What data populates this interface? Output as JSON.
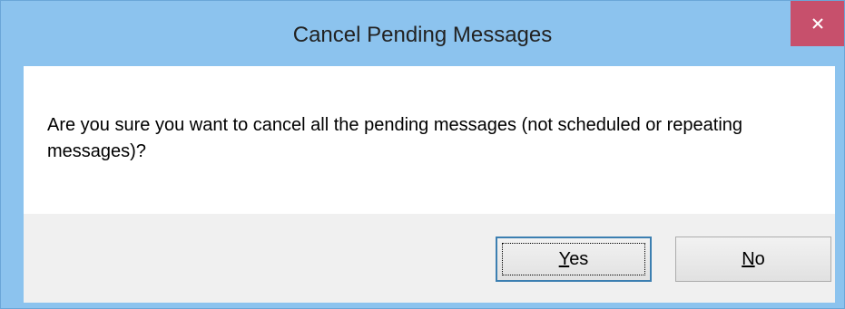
{
  "dialog": {
    "title": "Cancel Pending Messages",
    "close_icon": "close-icon",
    "message": "Are you sure you want to cancel all the pending messages (not scheduled or repeating messages)?",
    "buttons": {
      "yes": {
        "mnemonic": "Y",
        "rest": "es"
      },
      "no": {
        "mnemonic": "N",
        "rest": "o"
      }
    }
  },
  "colors": {
    "frame": "#8cc3ee",
    "close_button": "#c7506c",
    "client_background": "#f0f0f0",
    "focus_border": "#3c7fb1"
  }
}
